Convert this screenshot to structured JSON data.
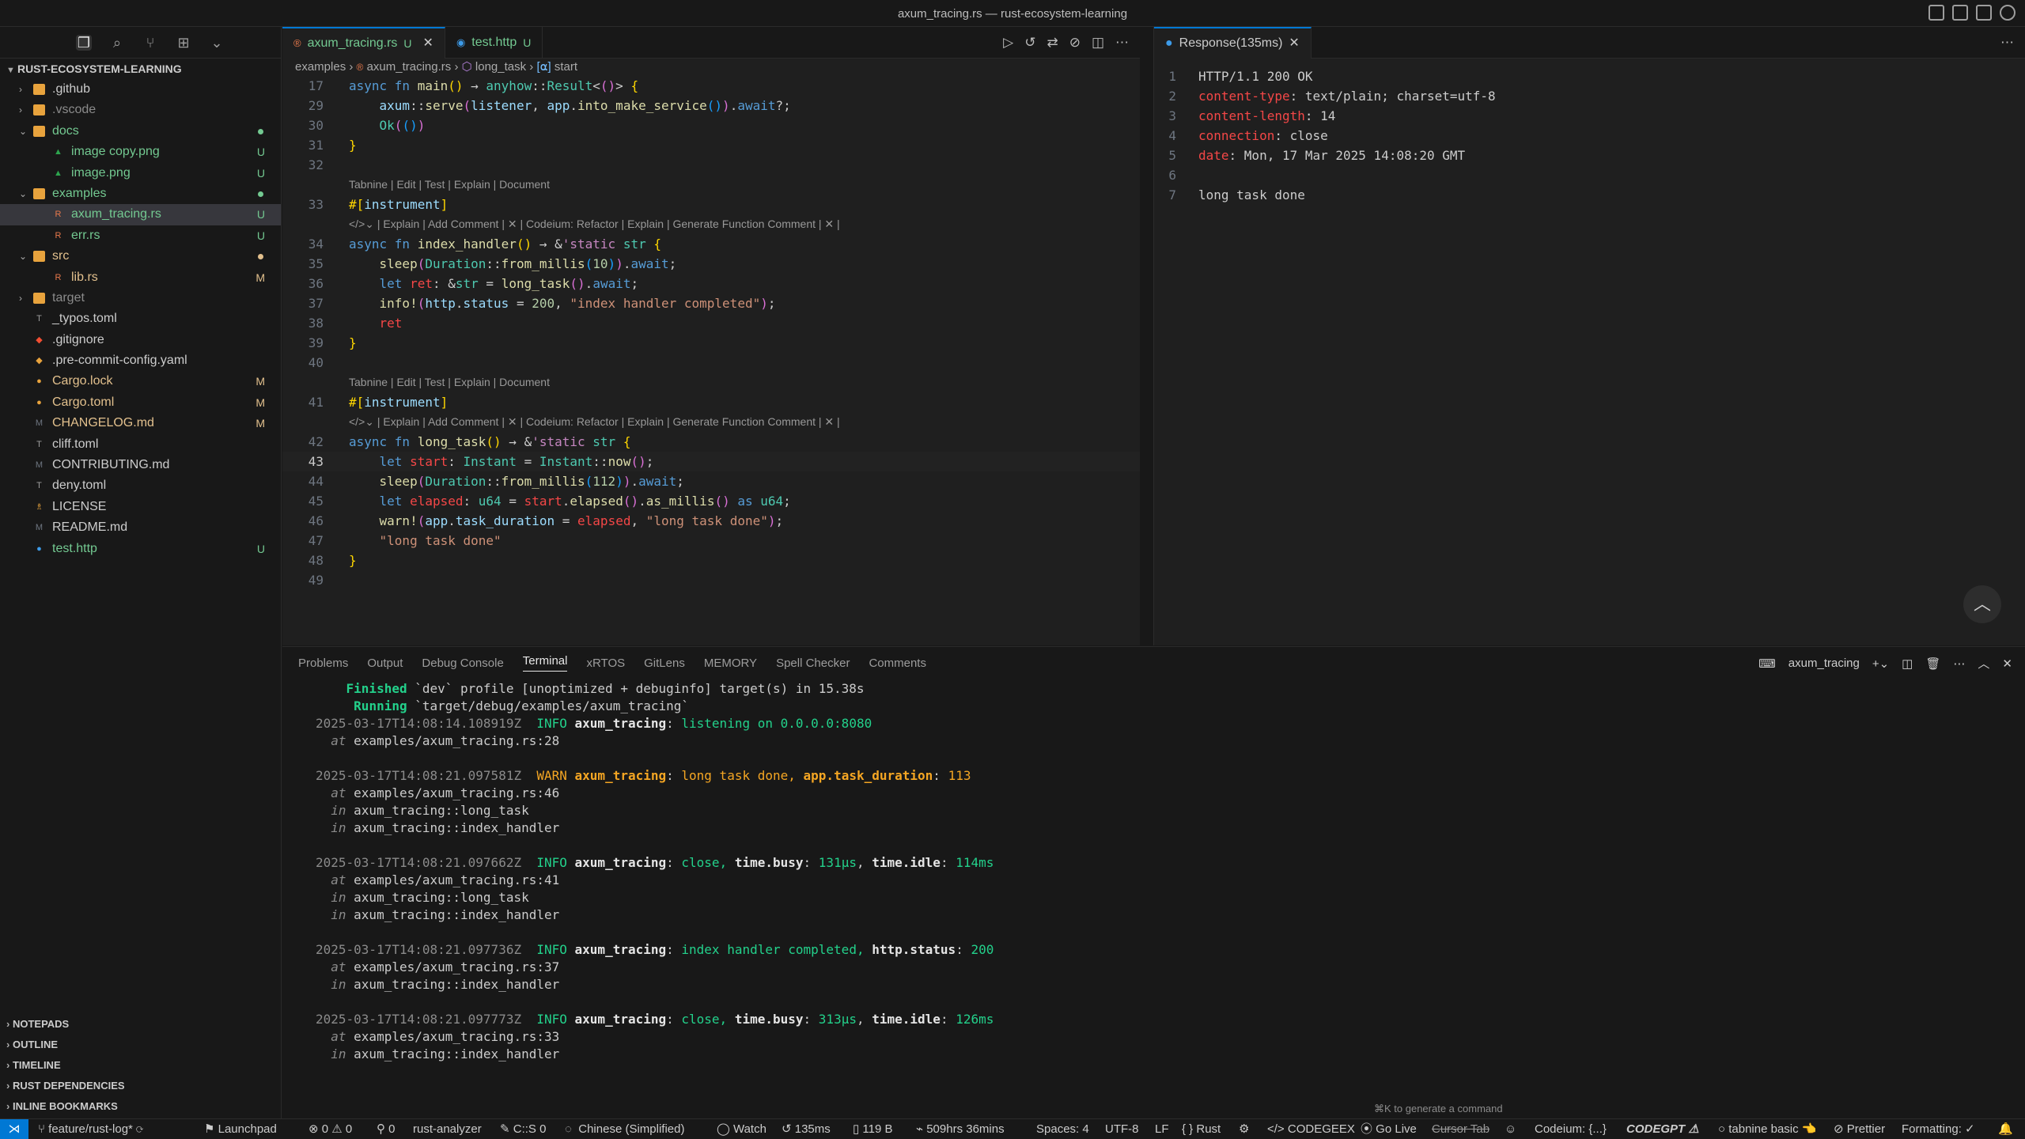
{
  "window": {
    "title": "axum_tracing.rs — rust-ecosystem-learning"
  },
  "explorer": {
    "root": "RUST-ECOSYSTEM-LEARNING",
    "items": [
      {
        "name": ".github",
        "kind": "folder",
        "collapsed": true,
        "color": "#cccccc",
        "badge": "",
        "depth": 0
      },
      {
        "name": ".vscode",
        "kind": "folder",
        "collapsed": true,
        "color": "#8b8b8b",
        "badge": "",
        "depth": 0
      },
      {
        "name": "docs",
        "kind": "folder",
        "collapsed": false,
        "color": "#73c991",
        "badge": "dot",
        "depth": 0
      },
      {
        "name": "image copy.png",
        "kind": "image",
        "color": "#73c991",
        "badge": "U",
        "depth": 1
      },
      {
        "name": "image.png",
        "kind": "image",
        "color": "#73c991",
        "badge": "U",
        "depth": 1
      },
      {
        "name": "examples",
        "kind": "folder",
        "collapsed": false,
        "color": "#73c991",
        "badge": "dot",
        "depth": 0
      },
      {
        "name": "axum_tracing.rs",
        "kind": "rust",
        "color": "#73c991",
        "badge": "U",
        "depth": 1,
        "selected": true
      },
      {
        "name": "err.rs",
        "kind": "rust",
        "color": "#73c991",
        "badge": "U",
        "depth": 1
      },
      {
        "name": "src",
        "kind": "folder",
        "collapsed": false,
        "color": "#e2c08d",
        "badge": "dot",
        "depth": 0
      },
      {
        "name": "lib.rs",
        "kind": "rust",
        "color": "#e2c08d",
        "badge": "M",
        "depth": 1
      },
      {
        "name": "target",
        "kind": "folder",
        "collapsed": true,
        "color": "#8b8b8b",
        "badge": "",
        "depth": 0
      },
      {
        "name": "_typos.toml",
        "kind": "toml",
        "color": "#cccccc",
        "badge": "",
        "depth": 0
      },
      {
        "name": ".gitignore",
        "kind": "git",
        "color": "#cccccc",
        "badge": "",
        "depth": 0
      },
      {
        "name": ".pre-commit-config.yaml",
        "kind": "yaml",
        "color": "#cccccc",
        "badge": "",
        "depth": 0
      },
      {
        "name": "Cargo.lock",
        "kind": "cargo",
        "color": "#e2c08d",
        "badge": "M",
        "depth": 0
      },
      {
        "name": "Cargo.toml",
        "kind": "cargo",
        "color": "#e2c08d",
        "badge": "M",
        "depth": 0
      },
      {
        "name": "CHANGELOG.md",
        "kind": "md",
        "color": "#e2c08d",
        "badge": "M",
        "depth": 0
      },
      {
        "name": "cliff.toml",
        "kind": "toml",
        "color": "#cccccc",
        "badge": "",
        "depth": 0
      },
      {
        "name": "CONTRIBUTING.md",
        "kind": "md",
        "color": "#cccccc",
        "badge": "",
        "depth": 0
      },
      {
        "name": "deny.toml",
        "kind": "toml",
        "color": "#cccccc",
        "badge": "",
        "depth": 0
      },
      {
        "name": "LICENSE",
        "kind": "license",
        "color": "#cccccc",
        "badge": "",
        "depth": 0
      },
      {
        "name": "README.md",
        "kind": "md",
        "color": "#cccccc",
        "badge": "",
        "depth": 0
      },
      {
        "name": "test.http",
        "kind": "http",
        "color": "#73c991",
        "badge": "U",
        "depth": 0
      }
    ],
    "sections": [
      "NOTEPADS",
      "OUTLINE",
      "TIMELINE",
      "RUST DEPENDENCIES",
      "INLINE BOOKMARKS"
    ]
  },
  "editor": {
    "tabs": [
      {
        "label": "axum_tracing.rs",
        "status": "U",
        "active": true
      },
      {
        "label": "test.http",
        "status": "U",
        "active": false
      }
    ],
    "breadcrumb": [
      "examples",
      "axum_tracing.rs",
      "long_task",
      "start"
    ],
    "lens_top": "Tabnine | Edit | Test | Explain | Document",
    "lens_codeium": "| Explain | Add Comment |  ✕  | Codeium: Refactor | Explain | Generate Function Comment | ✕ |",
    "current_line": "43"
  },
  "response": {
    "tab": "Response(135ms)",
    "lines": [
      {
        "n": "1",
        "key": "",
        "text": "HTTP/1.1 200 OK"
      },
      {
        "n": "2",
        "key": "content-type",
        "text": "text/plain; charset=utf-8"
      },
      {
        "n": "3",
        "key": "content-length",
        "text": "14"
      },
      {
        "n": "4",
        "key": "connection",
        "text": "close"
      },
      {
        "n": "5",
        "key": "date",
        "text": "Mon, 17 Mar 2025 14:08:20 GMT"
      },
      {
        "n": "6",
        "key": "",
        "text": ""
      },
      {
        "n": "7",
        "key": "",
        "text": "long task done"
      }
    ]
  },
  "panel": {
    "tabs": [
      "Problems",
      "Output",
      "Debug Console",
      "Terminal",
      "xRTOS",
      "GitLens",
      "MEMORY",
      "Spell Checker",
      "Comments"
    ],
    "active_tab": "Terminal",
    "terminal_name": "axum_tracing",
    "hint": "⌘K to generate a command"
  },
  "statusbar": {
    "branch": "feature/rust-log*",
    "launchpad": "Launchpad",
    "errors": "0",
    "warnings": "0",
    "ports": "0",
    "analyzer": "rust-analyzer",
    "cs": "C::S 0",
    "lang_pack": "Chinese (Simplified)",
    "watch": "Watch",
    "time": "135ms",
    "size": "119 B",
    "hours": "509hrs 36mins",
    "spaces": "Spaces: 4",
    "encoding": "UTF-8",
    "eol": "LF",
    "language": "Rust",
    "codegeex": "CODEGEEX",
    "golive": "Go Live",
    "cursortab": "Cursor Tab",
    "codeium": "Codeium: {...}",
    "codegpt": "CODEGPT",
    "tabnine": "tabnine basic",
    "prettier": "Prettier",
    "formatting": "Formatting: ✓"
  }
}
